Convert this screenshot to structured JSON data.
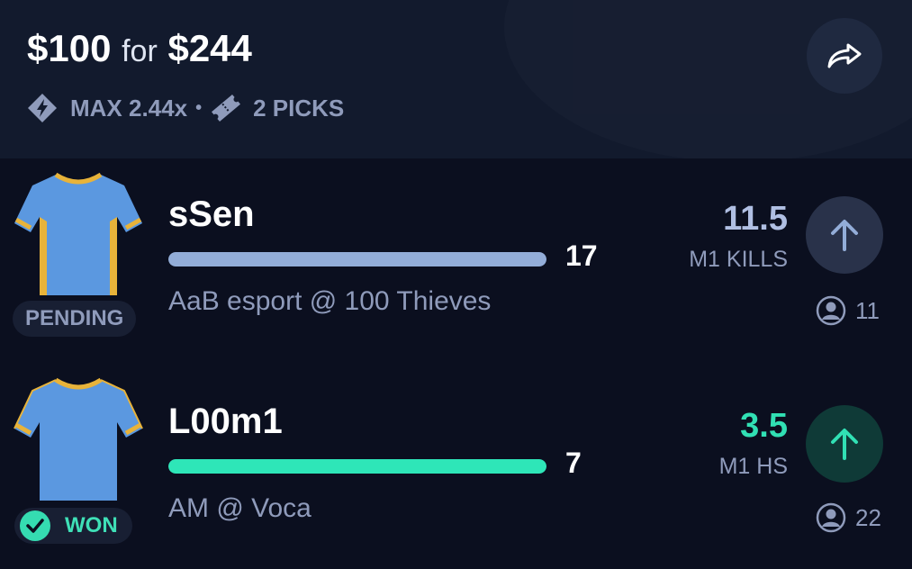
{
  "header": {
    "stake": "$100",
    "for_label": "for",
    "payout": "$244",
    "max_text": "MAX 2.44x",
    "separator": "•",
    "picks_text": "2 PICKS"
  },
  "picks": [
    {
      "player": "sSen",
      "status": "PENDING",
      "current_value": "17",
      "progress": 1.0,
      "bar_color": "#93add8",
      "matchup": "AaB esport @ 100 Thieves",
      "line": "11.5",
      "line_color": "#b0bfe3",
      "stat": "M1 KILLS",
      "direction": "up",
      "users_count": "11"
    },
    {
      "player": "L00m1",
      "status": "WON",
      "current_value": "7",
      "progress": 1.0,
      "bar_color": "#2ee6b8",
      "matchup": "AM @ Voca",
      "line": "3.5",
      "line_color": "#31e0b4",
      "stat": "M1 HS",
      "direction": "up",
      "users_count": "22"
    }
  ],
  "colors": {
    "background": "#0b0f1f",
    "header": "#121a2d",
    "won_accent": "#35dcb1",
    "jersey_body": "#5b98e0",
    "jersey_trim": "#e8b33a"
  }
}
